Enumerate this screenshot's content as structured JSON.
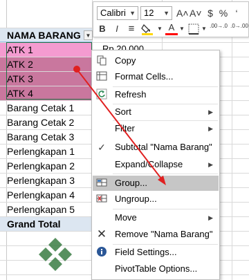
{
  "toolbar": {
    "font_name": "Calibri",
    "font_size": "12",
    "grow_font": "A˄",
    "shrink_font": "A˅",
    "currency": "$",
    "percent": "%",
    "comma": "‘",
    "bold": "B",
    "italic": "I",
    "align": "≡",
    "font_color": "A",
    "decrease_decimal": ".00→.0",
    "increase_decimal": ".0→.00"
  },
  "sheet": {
    "header": "NAMA BARANG",
    "rows": [
      "ATK 1",
      "ATK 2",
      "ATK 3",
      "ATK 4",
      "Barang Cetak 1",
      "Barang Cetak 2",
      "Barang Cetak 3",
      "Perlengkapan 1",
      "Perlengkapan 2",
      "Perlengkapan 3",
      "Perlengkapan 4",
      "Perlengkapan 5"
    ],
    "total": "Grand Total",
    "value_cell": "Rp    20.000"
  },
  "menu": {
    "items": [
      {
        "label": "Copy",
        "icon": "copy-icon"
      },
      {
        "label": "Format Cells...",
        "icon": "format-cells-icon"
      },
      {
        "label": "Refresh",
        "icon": "refresh-icon"
      },
      {
        "label": "Sort",
        "icon": "",
        "submenu": true
      },
      {
        "label": "Filter",
        "icon": "",
        "submenu": true
      },
      {
        "label": "Subtotal \"Nama Barang\"",
        "icon": "check-icon"
      },
      {
        "label": "Expand/Collapse",
        "icon": "",
        "submenu": true
      },
      {
        "label": "Group...",
        "icon": "group-icon",
        "highlighted": true
      },
      {
        "label": "Ungroup...",
        "icon": "ungroup-icon"
      },
      {
        "label": "Move",
        "icon": "",
        "submenu": true
      },
      {
        "label": "Remove \"Nama Barang\"",
        "icon": "remove-icon"
      },
      {
        "label": "Field Settings...",
        "icon": "field-settings-icon"
      },
      {
        "label": "PivotTable Options...",
        "icon": ""
      }
    ]
  },
  "colors": {
    "atk1": "#f49bd0",
    "atk_selected": "#c9779e",
    "header_bg": "#dce6f1",
    "menu_highlight": "#c6c6c6",
    "arrow": "#e02020"
  }
}
